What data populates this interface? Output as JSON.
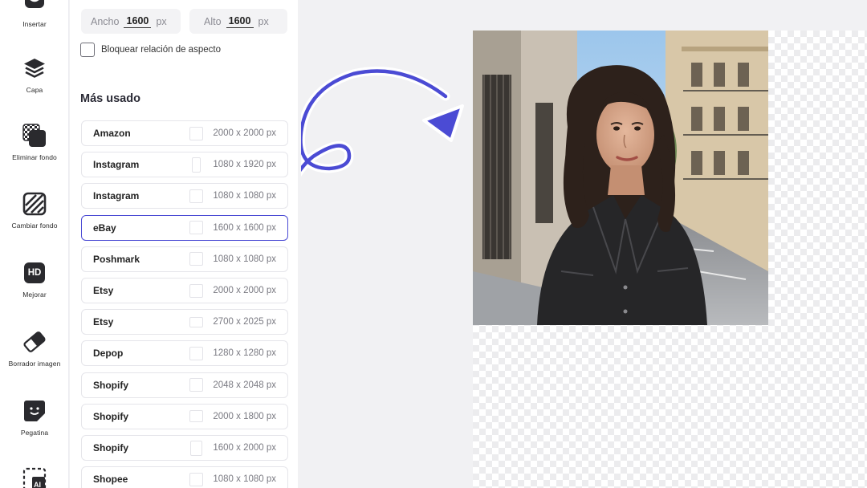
{
  "rail": {
    "items": [
      {
        "label": "Insertar",
        "icon": "insert-icon"
      },
      {
        "label": "Capa",
        "icon": "layers-icon"
      },
      {
        "label": "Eliminar fondo",
        "icon": "remove-background-icon"
      },
      {
        "label": "Cambiar fondo",
        "icon": "change-background-icon"
      },
      {
        "label": "Mejorar",
        "icon": "hd-enhance-icon",
        "badge": "HD"
      },
      {
        "label": "Borrador imagen",
        "icon": "eraser-icon"
      },
      {
        "label": "Pegatina",
        "icon": "sticker-icon"
      },
      {
        "label": "",
        "icon": "ai-tool-icon",
        "badge": "AI"
      }
    ]
  },
  "panel": {
    "width": {
      "label": "Ancho",
      "value": "1600",
      "unit": "px"
    },
    "height": {
      "label": "Alto",
      "value": "1600",
      "unit": "px"
    },
    "lock_label": "Bloquear relación de aspecto",
    "section_title": "Más usado",
    "presets": [
      {
        "name": "Amazon",
        "size": "2000 x 2000 px",
        "selected": false
      },
      {
        "name": "Instagram",
        "size": "1080 x 1920 px",
        "selected": false
      },
      {
        "name": "Instagram",
        "size": "1080 x 1080 px",
        "selected": false
      },
      {
        "name": "eBay",
        "size": "1600 x 1600 px",
        "selected": true
      },
      {
        "name": "Poshmark",
        "size": "1080 x 1080 px",
        "selected": false
      },
      {
        "name": "Etsy",
        "size": "2000 x 2000 px",
        "selected": false
      },
      {
        "name": "Etsy",
        "size": "2700 x 2025 px",
        "selected": false
      },
      {
        "name": "Depop",
        "size": "1280 x 1280 px",
        "selected": false
      },
      {
        "name": "Shopify",
        "size": "2048 x 2048 px",
        "selected": false
      },
      {
        "name": "Shopify",
        "size": "2000 x 1800 px",
        "selected": false
      },
      {
        "name": "Shopify",
        "size": "1600 x 2000 px",
        "selected": false
      },
      {
        "name": "Shopee",
        "size": "1080 x 1080 px",
        "selected": false
      }
    ]
  },
  "canvas": {
    "image": "portrait-photo",
    "accent_color": "#4b4bd4"
  }
}
